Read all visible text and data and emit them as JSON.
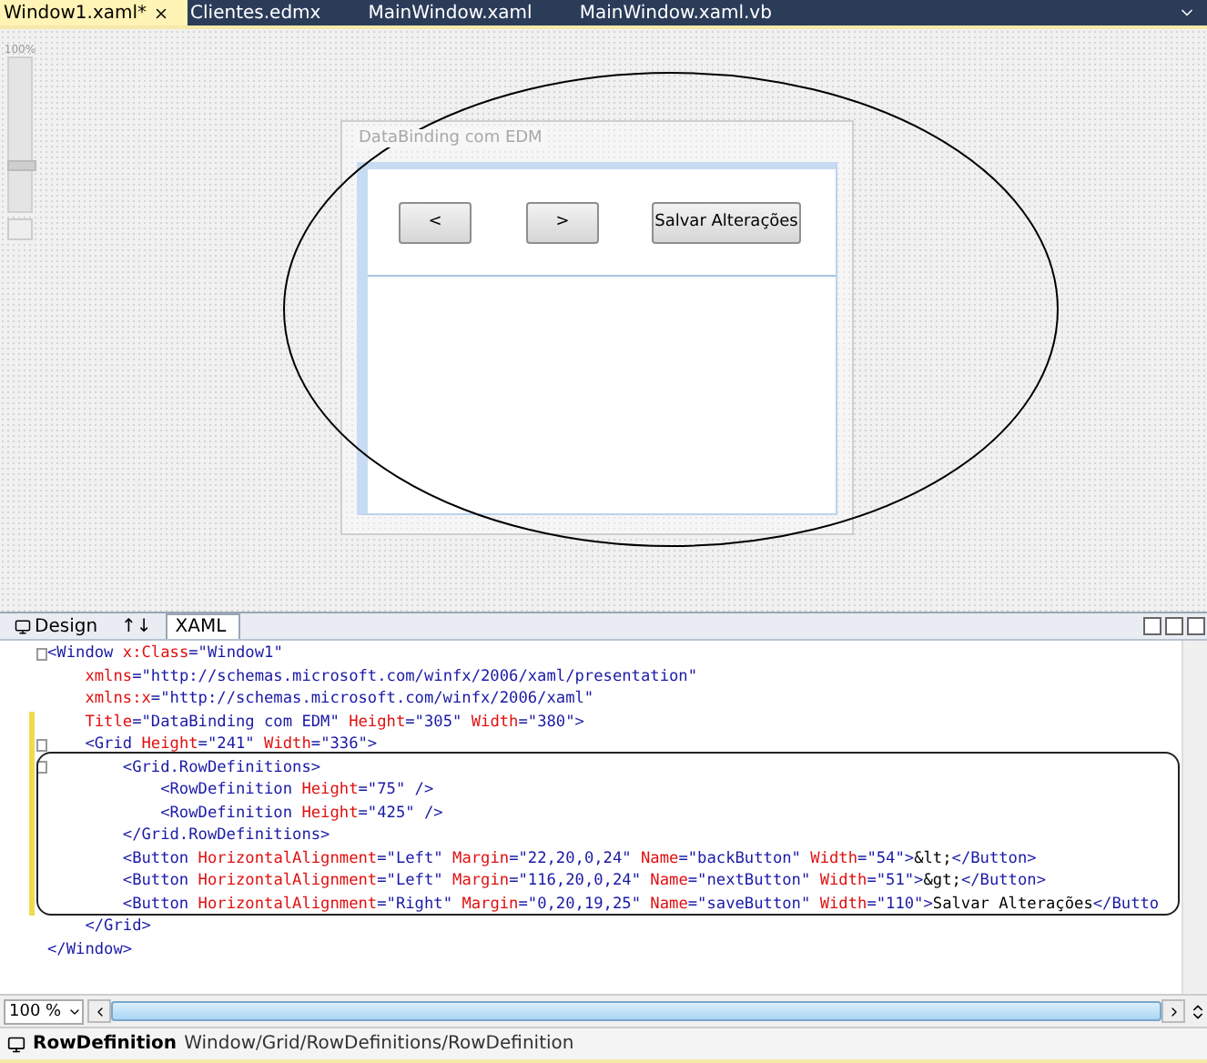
{
  "document_tabs": [
    {
      "label": "Window1.xaml*",
      "selected": true,
      "closable": true
    },
    {
      "label": "Clientes.edmx",
      "selected": false,
      "closable": false
    },
    {
      "label": "MainWindow.xaml",
      "selected": false,
      "closable": false
    },
    {
      "label": "MainWindow.xaml.vb",
      "selected": false,
      "closable": false
    }
  ],
  "designer": {
    "zoom_label": "100%",
    "zoom_slider": {
      "level": 0.3
    },
    "window_title": "DataBinding com EDM",
    "buttons": [
      "<",
      ">",
      "Salvar Alterações"
    ]
  },
  "view_tabs": [
    {
      "label": "Design",
      "kind": "design",
      "selected": false
    },
    {
      "label": "↑↓",
      "kind": "swap",
      "selected": false
    },
    {
      "label": "XAML",
      "kind": "xaml",
      "selected": true
    }
  ],
  "code_lines": [
    {
      "fold": true,
      "changed": false,
      "tokens": [
        {
          "kind": "tag",
          "text": "<Window "
        },
        {
          "kind": "attr",
          "text": "x:Class"
        },
        {
          "kind": "value",
          "text": "=\"Window1\""
        }
      ]
    },
    {
      "fold": false,
      "changed": false,
      "tokens": [
        {
          "kind": "attr",
          "text": "    xmlns"
        },
        {
          "kind": "value",
          "text": "=\"http://schemas.microsoft.com/winfx/2006/xaml/presentation\""
        }
      ]
    },
    {
      "fold": false,
      "changed": false,
      "tokens": [
        {
          "kind": "attr",
          "text": "    xmlns:x"
        },
        {
          "kind": "value",
          "text": "=\"http://schemas.microsoft.com/winfx/2006/xaml\""
        }
      ]
    },
    {
      "fold": false,
      "changed": true,
      "tokens": [
        {
          "kind": "attr",
          "text": "    Title"
        },
        {
          "kind": "value",
          "text": "=\"DataBinding com EDM\" "
        },
        {
          "kind": "attr",
          "text": "Height"
        },
        {
          "kind": "value",
          "text": "=\"305\" "
        },
        {
          "kind": "attr",
          "text": "Width"
        },
        {
          "kind": "value",
          "text": "=\"380\">"
        }
      ]
    },
    {
      "fold": true,
      "changed": true,
      "tokens": [
        {
          "kind": "tag",
          "text": "    <Grid "
        },
        {
          "kind": "attr",
          "text": "Height"
        },
        {
          "kind": "value",
          "text": "=\"241\" "
        },
        {
          "kind": "attr",
          "text": "Width"
        },
        {
          "kind": "value",
          "text": "=\"336\">"
        }
      ]
    },
    {
      "fold": true,
      "changed": true,
      "tokens": [
        {
          "kind": "tag",
          "text": "        <Grid.RowDefinitions>"
        }
      ]
    },
    {
      "fold": false,
      "changed": true,
      "tokens": [
        {
          "kind": "tag",
          "text": "            <RowDefinition "
        },
        {
          "kind": "attr",
          "text": "Height"
        },
        {
          "kind": "value",
          "text": "=\"75\" />"
        }
      ]
    },
    {
      "fold": false,
      "changed": true,
      "tokens": [
        {
          "kind": "tag",
          "text": "            <RowDefinition "
        },
        {
          "kind": "attr",
          "text": "Height"
        },
        {
          "kind": "value",
          "text": "=\"425\" />"
        }
      ]
    },
    {
      "fold": false,
      "changed": true,
      "tokens": [
        {
          "kind": "tag",
          "text": "        </Grid.RowDefinitions>"
        }
      ]
    },
    {
      "fold": false,
      "changed": true,
      "tokens": [
        {
          "kind": "tag",
          "text": "        <Button "
        },
        {
          "kind": "attr",
          "text": "HorizontalAlignment"
        },
        {
          "kind": "value",
          "text": "=\"Left\" "
        },
        {
          "kind": "attr",
          "text": "Margin"
        },
        {
          "kind": "value",
          "text": "=\"22,20,0,24\" "
        },
        {
          "kind": "attr",
          "text": "Name"
        },
        {
          "kind": "value",
          "text": "=\"backButton\" "
        },
        {
          "kind": "attr",
          "text": "Width"
        },
        {
          "kind": "value",
          "text": "=\"54\">"
        },
        {
          "kind": "text",
          "text": "&lt;"
        },
        {
          "kind": "tag",
          "text": "</Button>"
        }
      ]
    },
    {
      "fold": false,
      "changed": true,
      "tokens": [
        {
          "kind": "tag",
          "text": "        <Button "
        },
        {
          "kind": "attr",
          "text": "HorizontalAlignment"
        },
        {
          "kind": "value",
          "text": "=\"Left\" "
        },
        {
          "kind": "attr",
          "text": "Margin"
        },
        {
          "kind": "value",
          "text": "=\"116,20,0,24\" "
        },
        {
          "kind": "attr",
          "text": "Name"
        },
        {
          "kind": "value",
          "text": "=\"nextButton\" "
        },
        {
          "kind": "attr",
          "text": "Width"
        },
        {
          "kind": "value",
          "text": "=\"51\">"
        },
        {
          "kind": "text",
          "text": "&gt;"
        },
        {
          "kind": "tag",
          "text": "</Button>"
        }
      ]
    },
    {
      "fold": false,
      "changed": true,
      "tokens": [
        {
          "kind": "tag",
          "text": "        <Button "
        },
        {
          "kind": "attr",
          "text": "HorizontalAlignment"
        },
        {
          "kind": "value",
          "text": "=\"Right\" "
        },
        {
          "kind": "attr",
          "text": "Margin"
        },
        {
          "kind": "value",
          "text": "=\"0,20,19,25\" "
        },
        {
          "kind": "attr",
          "text": "Name"
        },
        {
          "kind": "value",
          "text": "=\"saveButton\" "
        },
        {
          "kind": "attr",
          "text": "Width"
        },
        {
          "kind": "value",
          "text": "=\"110\">"
        },
        {
          "kind": "text",
          "text": "Salvar Alterações"
        },
        {
          "kind": "tag",
          "text": "</Butto"
        }
      ]
    },
    {
      "fold": false,
      "changed": false,
      "tokens": [
        {
          "kind": "tag",
          "text": "    </Grid>"
        }
      ]
    },
    {
      "fold": false,
      "changed": false,
      "tokens": [
        {
          "kind": "tag",
          "text": "</Window>"
        }
      ]
    }
  ],
  "zoom_combo": {
    "value": "100 %"
  },
  "status_bar": {
    "element": "RowDefinition",
    "path": "Window/Grid/RowDefinitions/RowDefinition"
  }
}
